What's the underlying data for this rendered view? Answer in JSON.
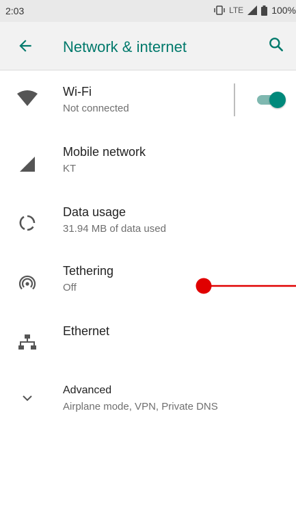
{
  "status_bar": {
    "time": "2:03",
    "network": "LTE",
    "battery": "100%"
  },
  "app_bar": {
    "title": "Network & internet",
    "back_icon": "arrow-back-icon",
    "search_icon": "search-icon"
  },
  "items": [
    {
      "label": "Wi-Fi",
      "subtitle": "Not connected",
      "icon": "wifi-icon",
      "toggle_on": true
    },
    {
      "label": "Mobile network",
      "subtitle": "KT",
      "icon": "cell-signal-icon"
    },
    {
      "label": "Data usage",
      "subtitle": "31.94 MB of data used",
      "icon": "data-usage-icon"
    },
    {
      "label": "Tethering",
      "subtitle": "Off",
      "icon": "tethering-icon"
    },
    {
      "label": "Ethernet",
      "subtitle": "",
      "icon": "ethernet-icon"
    },
    {
      "label": "Advanced",
      "subtitle": "Airplane mode, VPN, Private DNS",
      "icon": "chevron-down-icon"
    }
  ],
  "colors": {
    "accent": "#00796b",
    "toggle_thumb": "#00897b",
    "toggle_track": "#7fb8b0",
    "pointer": "#e00000"
  }
}
